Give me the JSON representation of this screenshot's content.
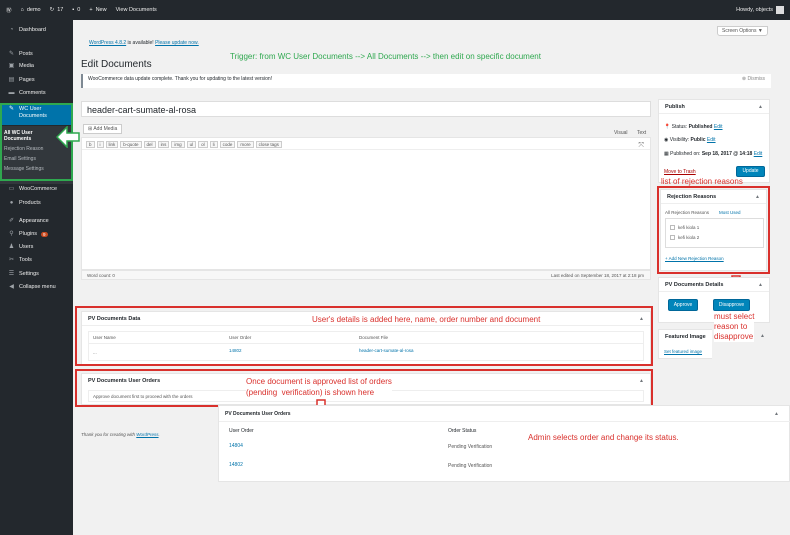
{
  "adminbar": {
    "site_name": "demo",
    "updates_count": "17",
    "comments_count": "0",
    "new_label": "New",
    "view_label": "View Documents",
    "howdy": "Howdy, objects"
  },
  "sidebar": {
    "items": [
      {
        "label": "Dashboard",
        "icon": "dashboard-icon"
      },
      {
        "label": "Posts",
        "icon": "pin-icon"
      },
      {
        "label": "Media",
        "icon": "media-icon"
      },
      {
        "label": "Pages",
        "icon": "page-icon"
      },
      {
        "label": "Comments",
        "icon": "comment-icon"
      },
      {
        "label": "WC User Documents",
        "icon": "pin-icon"
      }
    ],
    "submenu": [
      "All WC User Documents",
      "Rejection Reason",
      "Email Settings",
      "Message Settings"
    ],
    "items2": [
      {
        "label": "WooCommerce",
        "icon": "woo-icon"
      },
      {
        "label": "Products",
        "icon": "products-icon"
      },
      {
        "label": "Appearance",
        "icon": "brush-icon"
      },
      {
        "label": "Plugins",
        "icon": "plugin-icon",
        "badge": "9"
      },
      {
        "label": "Users",
        "icon": "users-icon"
      },
      {
        "label": "Tools",
        "icon": "tools-icon"
      },
      {
        "label": "Settings",
        "icon": "settings-icon"
      },
      {
        "label": "Collapse menu",
        "icon": "collapse-icon"
      }
    ]
  },
  "screen_options": "Screen Options ▼",
  "update_notice": {
    "pre": "WordPress 4.8.2",
    "mid": " is available! ",
    "link": "Please update now."
  },
  "page_title": "Edit Documents",
  "woo_notice": {
    "text": "WooCommerce data update complete. Thank you for updating to the latest version!",
    "dismiss": "Dismiss"
  },
  "post_title": "header-cart-sumate-al-rosa",
  "editor": {
    "add_media": "Add Media",
    "visual_tab": "Visual",
    "text_tab": "Text",
    "toolbar": [
      "b",
      "i",
      "link",
      "b-quote",
      "del",
      "ins",
      "img",
      "ul",
      "ol",
      "li",
      "code",
      "more",
      "close tags"
    ],
    "word_count": "Word count: 0",
    "last_edited": "Last edited on September 18, 2017 at 2:18 pm"
  },
  "publish": {
    "title": "Publish",
    "status_label": "Status:",
    "status_value": "Published",
    "status_edit": "Edit",
    "visibility_label": "Visibility:",
    "visibility_value": "Public",
    "visibility_edit": "Edit",
    "published_label": "Published on:",
    "published_value": "Sep 18, 2017 @ 14:18",
    "published_edit": "Edit",
    "trash": "Move to Trash",
    "update": "Update"
  },
  "rejection": {
    "title": "Rejection Reasons",
    "tab_all": "All Rejection Reasons",
    "tab_most": "Most Used",
    "options": [
      "kefi kiola 1",
      "kefi kiola 2"
    ],
    "add_new": "+ Add New Rejection Reason"
  },
  "pv_details": {
    "title": "PV Documents Details",
    "approve": "Approve",
    "disapprove": "Disapprove"
  },
  "featured": {
    "title": "Featured Image",
    "link": "Set featured image"
  },
  "pv_data": {
    "title": "PV Documents Data",
    "headers": [
      "User Name",
      "User Order",
      "Document File"
    ],
    "row": [
      "...",
      "14802",
      "header-cart-sumate-al-rosa"
    ]
  },
  "pv_orders": {
    "title": "PV Documents User Orders",
    "note": "Approve document first to proceed with the orders"
  },
  "pv_orders2": {
    "title": "PV Documents User Orders",
    "headers": [
      "User Order",
      "Order Status"
    ],
    "rows": [
      {
        "order": "14804",
        "status": "Pending Verification"
      },
      {
        "order": "14802",
        "status": "Pending Verification"
      }
    ]
  },
  "footer": {
    "pre": "Thank you for creating with ",
    "link": "WordPress",
    "post": "."
  },
  "annotations": {
    "trigger_label": "Trigger:",
    "trigger_text": "from WC User Documents --> All Documents  --> then edit on specific document",
    "rejection_list": "list of rejection reasons",
    "details_added": "User's details is added here, name, order number and document",
    "orders_shown": "Once document is approved list of orders\n(pending  verification) is shown here",
    "admin_selects": "Admin selects order and change its status.",
    "must_select": "must select\nreason to\ndisapprove"
  }
}
